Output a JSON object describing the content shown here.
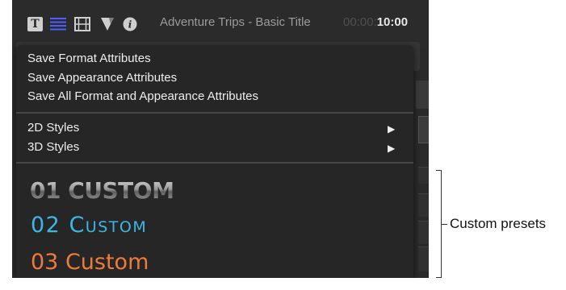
{
  "toolbar": {
    "icons": [
      "text-inspector-icon",
      "paragraph-lines-icon",
      "video-filmstrip-icon",
      "shape-icon",
      "info-icon"
    ],
    "title": "Adventure Trips - Basic Title",
    "timecode_dim": "00:00:",
    "timecode_bright": "10:00"
  },
  "menu": {
    "save_items": [
      "Save Format Attributes",
      "Save Appearance Attributes",
      "Save All Format and Appearance Attributes"
    ],
    "style_items": [
      {
        "label": "2D Styles",
        "arrow": "▶"
      },
      {
        "label": "3D Styles",
        "arrow": "▶"
      }
    ],
    "presets": [
      "01 CUSTOM",
      "02 Custom",
      "03 Custom"
    ],
    "preset_colors": [
      "#9a9a9a",
      "#3bb7e6",
      "#f07a3a"
    ]
  },
  "annotation": {
    "callout_label": "Custom presets"
  }
}
